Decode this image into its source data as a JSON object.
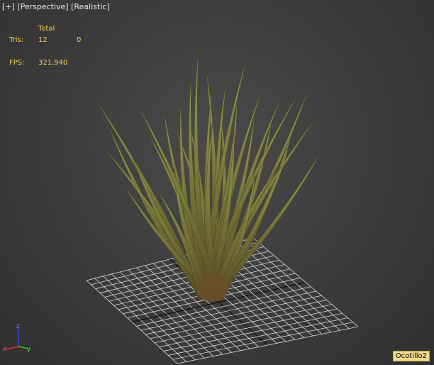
{
  "viewport": {
    "menu": {
      "plus": "[+]",
      "view": "[Perspective]",
      "shading": "[Realistic]"
    },
    "stats": {
      "header": "Total",
      "tris_label": "Tris:",
      "tris_total": "12",
      "tris_selected": "0",
      "fps_label": "FPS:",
      "fps_value": "321,940"
    },
    "axis_gizmo": {
      "x": "x",
      "y": "y",
      "z": "z"
    },
    "object_label": "Ocotillo2"
  },
  "colors": {
    "background": "#3b3b3b",
    "grid": "#d8d8d8",
    "grid_center": "#111111",
    "stats_text": "#f0d060",
    "label_bg": "#f2dc8a"
  }
}
